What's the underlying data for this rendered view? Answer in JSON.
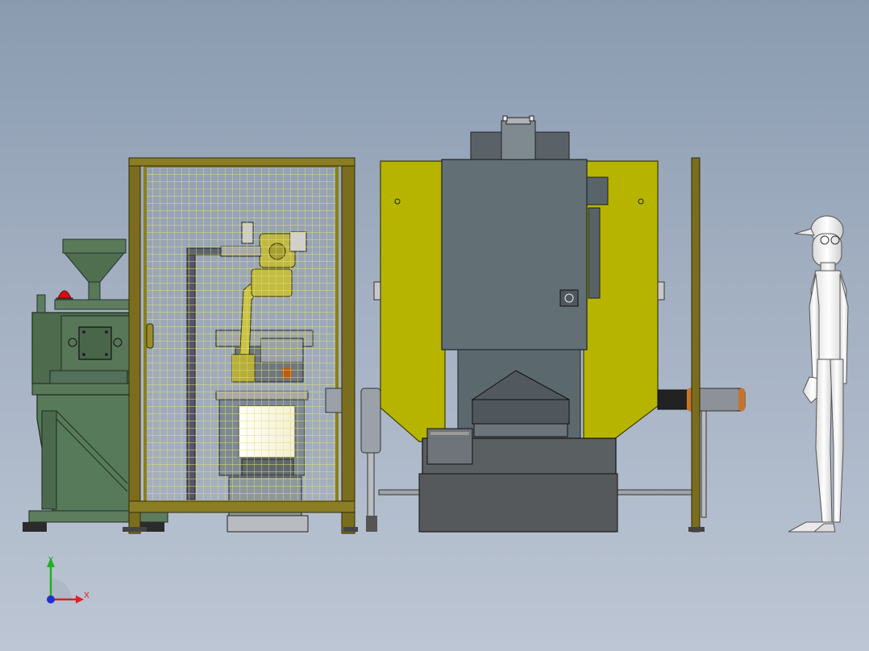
{
  "triad": {
    "x_label": "X",
    "y_label": "Y",
    "x_color": "#e02020",
    "y_color": "#20b020",
    "z_color": "#2030d0"
  },
  "colors": {
    "background_top": "#8a9bb0",
    "background_bottom": "#bcc6d4",
    "frame_olive": "#7a6e1e",
    "mesh_yellow": "#e8e070",
    "guard_yellow": "#b7b400",
    "press_gray": "#627075",
    "machine_green": "#4e6b4e",
    "robot_yellow": "#c9c34a",
    "beacon_red": "#d01010",
    "person_white": "#f2f2f2"
  }
}
